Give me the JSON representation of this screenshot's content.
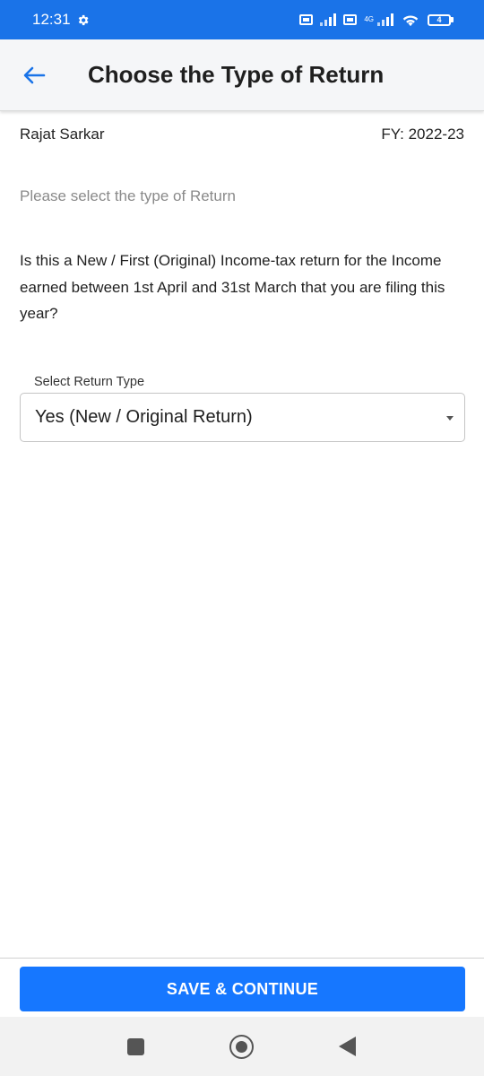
{
  "status_bar": {
    "time": "12:31",
    "battery": "4",
    "network": "4G"
  },
  "app_bar": {
    "title": "Choose the Type of Return",
    "back_icon": "arrow-left-icon"
  },
  "user": {
    "name": "Rajat Sarkar",
    "fy": "FY: 2022-23"
  },
  "hint": "Please select the type of Return",
  "question": "Is this a New / First (Original) Income-tax return for the Income earned between 1st April and 31st March that you are filing this year?",
  "return_type": {
    "label": "Select Return Type",
    "selected": "Yes (New / Original Return)"
  },
  "actions": {
    "save_label": "SAVE & CONTINUE"
  },
  "colors": {
    "accent": "#1a73e8",
    "button": "#1677ff"
  }
}
